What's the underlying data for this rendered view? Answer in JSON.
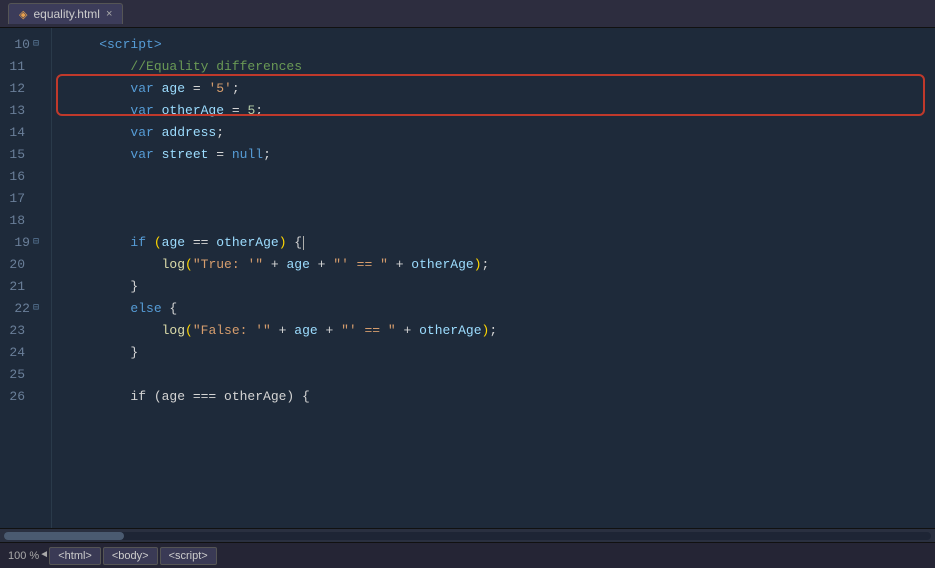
{
  "tab": {
    "filename": "equality.html",
    "icon": "◈",
    "close": "×"
  },
  "editor": {
    "lines": [
      {
        "num": 10,
        "foldable": true,
        "tokens": [
          {
            "t": "kw",
            "v": "    <script>"
          }
        ]
      },
      {
        "num": 11,
        "foldable": false,
        "tokens": [
          {
            "t": "cmt",
            "v": "        //Equality differences"
          }
        ]
      },
      {
        "num": 12,
        "foldable": false,
        "highlighted": true,
        "tokens": [
          {
            "t": "kw",
            "v": "        var "
          },
          {
            "t": "id",
            "v": "age"
          },
          {
            "t": "plain",
            "v": " = "
          },
          {
            "t": "str",
            "v": "'5'"
          },
          {
            "t": "plain",
            "v": ";"
          }
        ]
      },
      {
        "num": 13,
        "foldable": false,
        "highlighted": true,
        "tokens": [
          {
            "t": "kw",
            "v": "        var "
          },
          {
            "t": "id",
            "v": "otherAge"
          },
          {
            "t": "plain",
            "v": " = "
          },
          {
            "t": "num",
            "v": "5"
          },
          {
            "t": "plain",
            "v": ";"
          }
        ]
      },
      {
        "num": 14,
        "foldable": false,
        "tokens": [
          {
            "t": "kw",
            "v": "        var "
          },
          {
            "t": "id",
            "v": "address"
          },
          {
            "t": "plain",
            "v": ";"
          }
        ]
      },
      {
        "num": 15,
        "foldable": false,
        "tokens": [
          {
            "t": "kw",
            "v": "        var "
          },
          {
            "t": "id",
            "v": "street"
          },
          {
            "t": "plain",
            "v": " = "
          },
          {
            "t": "null-kw",
            "v": "null"
          },
          {
            "t": "plain",
            "v": ";"
          }
        ]
      },
      {
        "num": 16,
        "foldable": false,
        "tokens": []
      },
      {
        "num": 17,
        "foldable": false,
        "tokens": []
      },
      {
        "num": 18,
        "foldable": false,
        "tokens": []
      },
      {
        "num": 19,
        "foldable": true,
        "tokens": [
          {
            "t": "kw",
            "v": "        if "
          },
          {
            "t": "paren",
            "v": "("
          },
          {
            "t": "id",
            "v": "age"
          },
          {
            "t": "plain",
            "v": " == "
          },
          {
            "t": "id",
            "v": "otherAge"
          },
          {
            "t": "paren",
            "v": ")"
          },
          {
            "t": "plain",
            "v": " {"
          }
        ]
      },
      {
        "num": 20,
        "foldable": false,
        "tokens": [
          {
            "t": "plain",
            "v": "            "
          },
          {
            "t": "fn",
            "v": "log"
          },
          {
            "t": "paren",
            "v": "("
          },
          {
            "t": "str",
            "v": "\"True: '\""
          },
          {
            "t": "plain",
            "v": " + "
          },
          {
            "t": "id",
            "v": "age"
          },
          {
            "t": "plain",
            "v": " + "
          },
          {
            "t": "str",
            "v": "\"' == \""
          },
          {
            "t": "plain",
            "v": " + "
          },
          {
            "t": "id",
            "v": "otherAge"
          },
          {
            "t": "paren",
            "v": ")"
          },
          {
            "t": "plain",
            "v": ";"
          }
        ]
      },
      {
        "num": 21,
        "foldable": false,
        "tokens": [
          {
            "t": "plain",
            "v": "        }"
          }
        ]
      },
      {
        "num": 22,
        "foldable": true,
        "tokens": [
          {
            "t": "kw",
            "v": "        else "
          },
          {
            "t": "plain",
            "v": "{"
          }
        ]
      },
      {
        "num": 23,
        "foldable": false,
        "tokens": [
          {
            "t": "plain",
            "v": "            "
          },
          {
            "t": "fn",
            "v": "log"
          },
          {
            "t": "paren",
            "v": "("
          },
          {
            "t": "str",
            "v": "\"False: '\""
          },
          {
            "t": "plain",
            "v": " + "
          },
          {
            "t": "id",
            "v": "age"
          },
          {
            "t": "plain",
            "v": " + "
          },
          {
            "t": "str",
            "v": "\"' == \""
          },
          {
            "t": "plain",
            "v": " + "
          },
          {
            "t": "id",
            "v": "otherAge"
          },
          {
            "t": "paren",
            "v": ")"
          },
          {
            "t": "plain",
            "v": ";"
          }
        ]
      },
      {
        "num": 24,
        "foldable": false,
        "tokens": [
          {
            "t": "plain",
            "v": "        }"
          }
        ]
      },
      {
        "num": 25,
        "foldable": false,
        "tokens": []
      },
      {
        "num": 26,
        "foldable": false,
        "tokens": [
          {
            "t": "plain",
            "v": "        if (age === otherAge) {"
          }
        ]
      }
    ]
  },
  "status": {
    "zoom": "100 %",
    "breadcrumbs": [
      "<html>",
      "<body>",
      "<script>"
    ]
  }
}
